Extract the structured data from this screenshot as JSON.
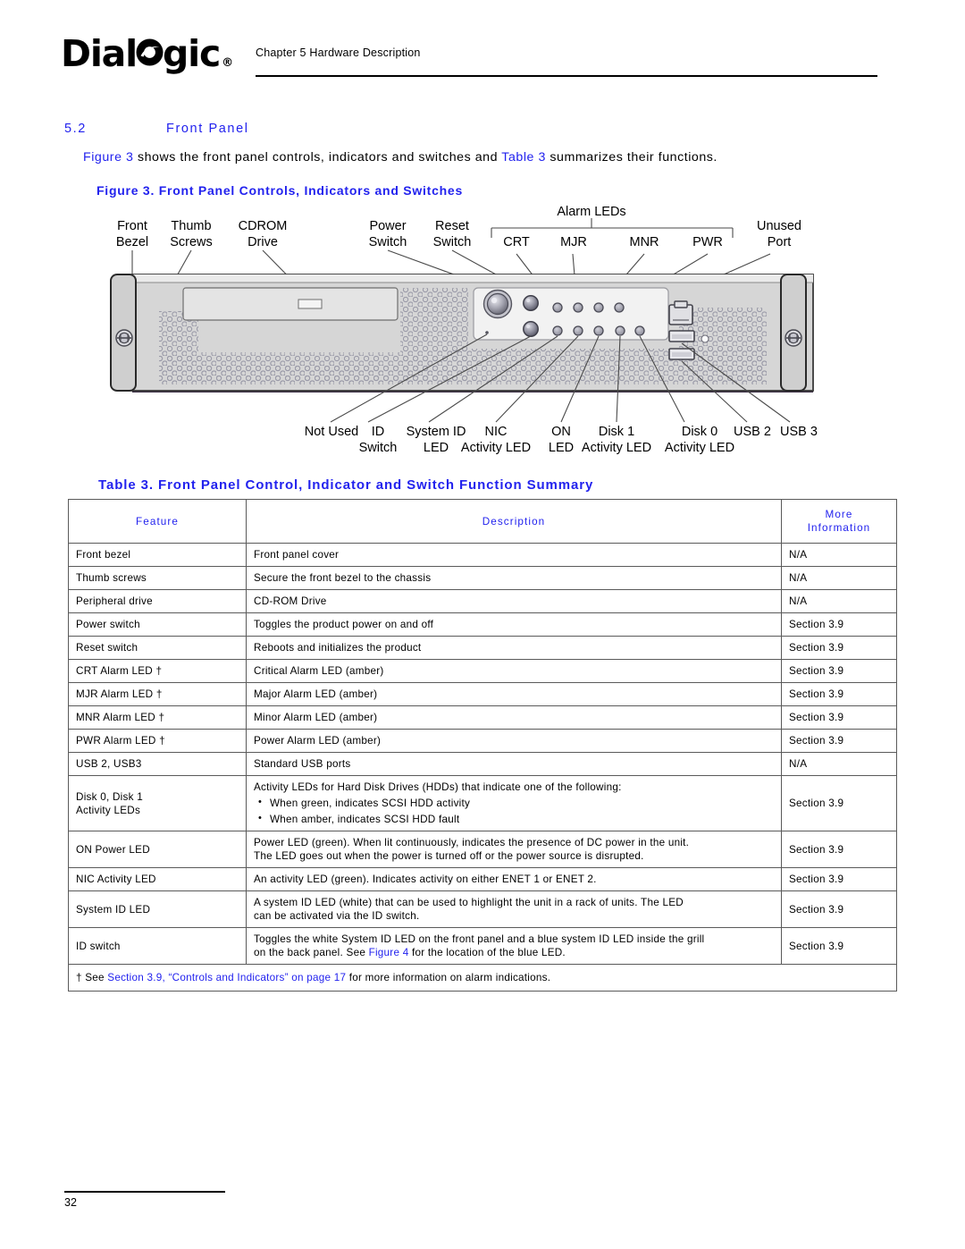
{
  "header": {
    "logo_text_before": "Dial",
    "logo_icon": "dialogic-o-logo-icon",
    "logo_text_after": "gic",
    "logo_registered": "®",
    "chapter": "Chapter 5 Hardware Description"
  },
  "section": {
    "number": "5.2",
    "title": "Front Panel",
    "intro_prefix": "",
    "intro_link_1": "Figure 3",
    "intro_mid": " shows the front panel controls, indicators and switches and ",
    "intro_link_2": "Table 3",
    "intro_suffix": " summarizes their functions."
  },
  "figure": {
    "caption": "Figure 3. Front Panel Controls, Indicators and Switches",
    "group_label": "Alarm LEDs",
    "top_labels": [
      {
        "line1": "Front",
        "line2": "Bezel"
      },
      {
        "line1": "Thumb",
        "line2": "Screws"
      },
      {
        "line1": "CDROM",
        "line2": "Drive"
      },
      {
        "line1": "Power",
        "line2": "Switch"
      },
      {
        "line1": "Reset",
        "line2": "Switch"
      },
      {
        "line1": "CRT",
        "line2": ""
      },
      {
        "line1": "MJR",
        "line2": ""
      },
      {
        "line1": "MNR",
        "line2": ""
      },
      {
        "line1": "PWR",
        "line2": ""
      },
      {
        "line1": "Unused",
        "line2": "Port"
      }
    ],
    "bottom_labels": [
      {
        "line1": "Not Used",
        "line2": ""
      },
      {
        "line1": "ID",
        "line2": "Switch"
      },
      {
        "line1": "System ID",
        "line2": "LED"
      },
      {
        "line1": "NIC",
        "line2": "Activity LED"
      },
      {
        "line1": "ON",
        "line2": "LED"
      },
      {
        "line1": "Disk 1",
        "line2": "Activity LED"
      },
      {
        "line1": "Disk 0",
        "line2": "Activity LED"
      },
      {
        "line1": "USB 2",
        "line2": ""
      },
      {
        "line1": "USB 3",
        "line2": ""
      }
    ]
  },
  "table": {
    "caption": "Table 3. Front Panel Control, Indicator and Switch Function Summary",
    "headers": {
      "feature": "Feature",
      "description": "Description",
      "more_line1": "More",
      "more_line2": "Information"
    },
    "rows": [
      {
        "feature": "Front bezel",
        "description": "Front panel cover",
        "more": "N/A",
        "more_is_link": false
      },
      {
        "feature": "Thumb screws",
        "description": "Secure the front bezel to the chassis",
        "more": "N/A",
        "more_is_link": false
      },
      {
        "feature": "Peripheral drive",
        "description": "CD-ROM Drive",
        "more": "N/A",
        "more_is_link": false
      },
      {
        "feature": "Power switch",
        "description": "Toggles the product power on and off",
        "more": "Section 3.9",
        "more_is_link": true
      },
      {
        "feature": "Reset switch",
        "description": "Reboots and initializes the product",
        "more": "Section 3.9",
        "more_is_link": true
      },
      {
        "feature": "CRT Alarm LED †",
        "description": "Critical Alarm LED (amber)",
        "more": "Section 3.9",
        "more_is_link": true
      },
      {
        "feature": "MJR Alarm LED †",
        "description": "Major Alarm LED (amber)",
        "more": "Section 3.9",
        "more_is_link": true
      },
      {
        "feature": "MNR Alarm LED †",
        "description": "Minor Alarm LED (amber)",
        "more": "Section 3.9",
        "more_is_link": true
      },
      {
        "feature": "PWR Alarm LED †",
        "description": "Power Alarm LED (amber)",
        "more": "Section 3.9",
        "more_is_link": true
      },
      {
        "feature": "USB 2, USB3",
        "description": "Standard USB ports",
        "more": "N/A",
        "more_is_link": false
      }
    ],
    "row_disk": {
      "feature_line1": "Disk 0, Disk 1",
      "feature_line2": "Activity LEDs",
      "desc_intro": "Activity LEDs for Hard Disk Drives (HDDs) that indicate one of the following:",
      "desc_bullets": [
        "When green, indicates SCSI HDD activity",
        "When amber, indicates SCSI HDD fault"
      ],
      "more": "Section 3.9"
    },
    "row_on_power": {
      "feature": "ON Power LED",
      "desc_line1": "Power LED (green). When lit continuously, indicates the presence of DC power in the unit.",
      "desc_line2": "The LED goes out when the power is turned off or the power source is disrupted.",
      "more": "Section 3.9"
    },
    "row_nic": {
      "feature": "NIC Activity LED",
      "description": "An activity LED (green). Indicates activity on either ENET 1 or ENET 2.",
      "more": "Section 3.9"
    },
    "row_system_id": {
      "feature": "System ID LED",
      "desc_line1": "A system ID LED (white) that can be used to highlight the unit in a rack of units. The LED",
      "desc_line2": "can be activated via the ID switch.",
      "more": "Section 3.9"
    },
    "row_id_switch": {
      "feature": "ID switch",
      "desc_line1": "Toggles the white System ID LED on the front panel and a blue system ID LED inside the grill",
      "desc_line2_pre": "on the back panel. See ",
      "desc_link": "Figure 4",
      "desc_line2_post": " for the location of the blue LED.",
      "more": "Section 3.9"
    },
    "footnote": {
      "marker": "† See ",
      "link": "Section 3.9, “Controls and Indicators” on page 17",
      "rest": " for more information on alarm indications."
    }
  },
  "footer": {
    "page_number": "32"
  },
  "colors": {
    "link_blue": "#2222EE",
    "text_black": "#000000",
    "chassis_fill": "#d6d6d6",
    "chassis_stroke": "#3a3a3a"
  }
}
